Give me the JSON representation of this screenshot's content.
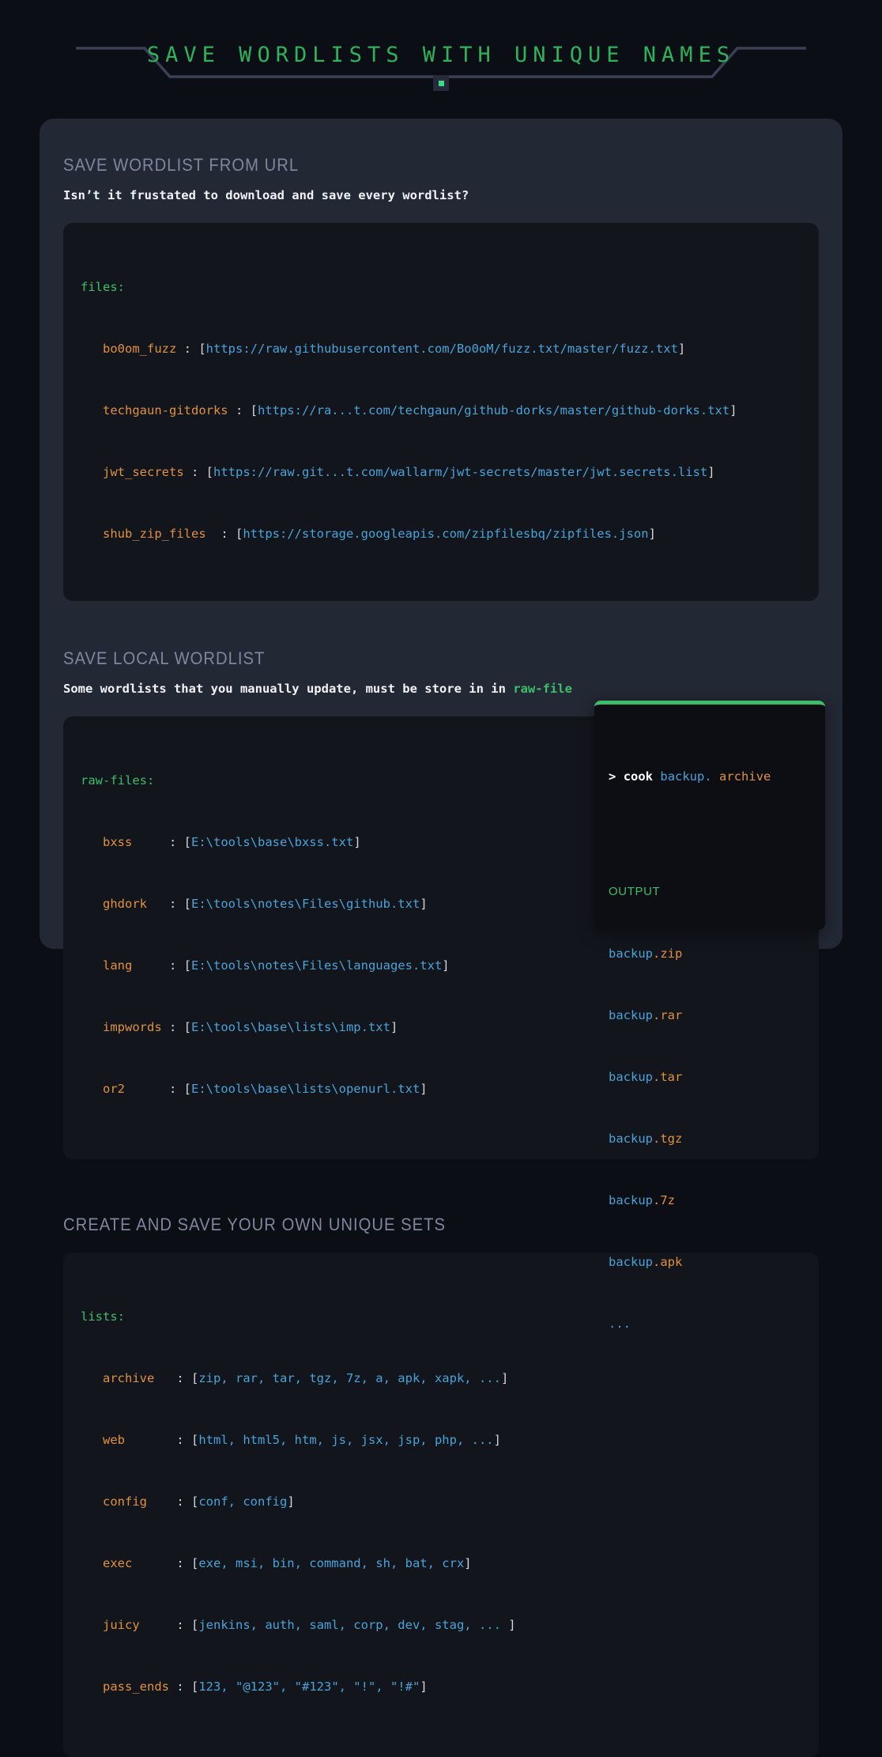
{
  "header": {
    "title": "SAVE WORDLISTS WITH UNIQUE NAMES",
    "accent_color": "#2eb35c",
    "badge_icon": "square-marker-icon"
  },
  "sections": [
    {
      "heading": "SAVE WORDLIST FROM URL",
      "description_prefix": "Isn’t it frustated to download and save every wordlist?",
      "description_highlight": "",
      "description_suffix": "",
      "code": {
        "root_key": "files:",
        "entries": [
          {
            "key": "bo0om_fuzz",
            "colon": " : ",
            "value": "https://raw.githubusercontent.com/Bo0oM/fuzz.txt/master/fuzz.txt"
          },
          {
            "key": "techgaun-gitdorks",
            "colon": " : ",
            "value": "https://ra...t.com/techgaun/github-dorks/master/github-dorks.txt"
          },
          {
            "key": "jwt_secrets",
            "colon": " : ",
            "value": "https://raw.git...t.com/wallarm/jwt-secrets/master/jwt.secrets.list"
          },
          {
            "key": "shub_zip_files",
            "colon": "  : ",
            "value": "https://storage.googleapis.com/zipfilesbq/zipfiles.json"
          }
        ]
      }
    },
    {
      "heading": "SAVE LOCAL WORDLIST",
      "description_prefix": "Some wordlists that you manually update, must be store in in ",
      "description_highlight": "raw-file",
      "description_suffix": "",
      "code": {
        "root_key": "raw-files:",
        "entries": [
          {
            "key": "bxss",
            "colon": "     : ",
            "value": "E:\\tools\\base\\bxss.txt"
          },
          {
            "key": "ghdork",
            "colon": "   : ",
            "value": "E:\\tools\\notes\\Files\\github.txt"
          },
          {
            "key": "lang",
            "colon": "     : ",
            "value": "E:\\tools\\notes\\Files\\languages.txt"
          },
          {
            "key": "impwords",
            "colon": " : ",
            "value": "E:\\tools\\base\\lists\\imp.txt"
          },
          {
            "key": "or2",
            "colon": "      : ",
            "value": "E:\\tools\\base\\lists\\openurl.txt"
          }
        ]
      }
    },
    {
      "heading": "CREATE AND SAVE YOUR OWN UNIQUE SETS",
      "description_prefix": "",
      "description_highlight": "",
      "description_suffix": "",
      "code": {
        "root_key": "lists:",
        "entries": [
          {
            "key": "archive",
            "colon": "   : ",
            "value": "zip, rar, tar, tgz, 7z, a, apk, xapk, ..."
          },
          {
            "key": "web",
            "colon": "       : ",
            "value": "html, html5, htm, js, jsx, jsp, php, ..."
          },
          {
            "key": "config",
            "colon": "    : ",
            "value": "conf, config"
          },
          {
            "key": "exec",
            "colon": "      : ",
            "value": "exe, msi, bin, command, sh, bat, crx"
          },
          {
            "key": "juicy",
            "colon": "     : ",
            "value": "jenkins, auth, saml, corp, dev, stag, ... "
          },
          {
            "key": "pass_ends",
            "colon": " : ",
            "value": "123, \"@123\", \"#123\", \"!\", \"!#\""
          }
        ]
      }
    }
  ],
  "terminal": {
    "prompt": ">",
    "command": "cook",
    "arg": "backup.",
    "set_name": "archive",
    "output_label": "OUTPUT",
    "output_lines": [
      {
        "base": "backup",
        "ext": ".zip"
      },
      {
        "base": "backup",
        "ext": ".rar"
      },
      {
        "base": "backup",
        "ext": ".tar"
      },
      {
        "base": "backup",
        "ext": ".tgz"
      },
      {
        "base": "backup",
        "ext": ".7z"
      },
      {
        "base": "backup",
        "ext": ".apk"
      }
    ],
    "ellipsis": "...",
    "accent_color": "#3dbd6a"
  },
  "colors": {
    "page_bg": "#0b0e14",
    "card_bg": "#232835",
    "code_bg": "#12151c",
    "green": "#3fbd6a",
    "orange": "#e0913f",
    "blue": "#4aa3d8",
    "punctuation": "#d4d8e0",
    "heading": "#7e879e"
  }
}
